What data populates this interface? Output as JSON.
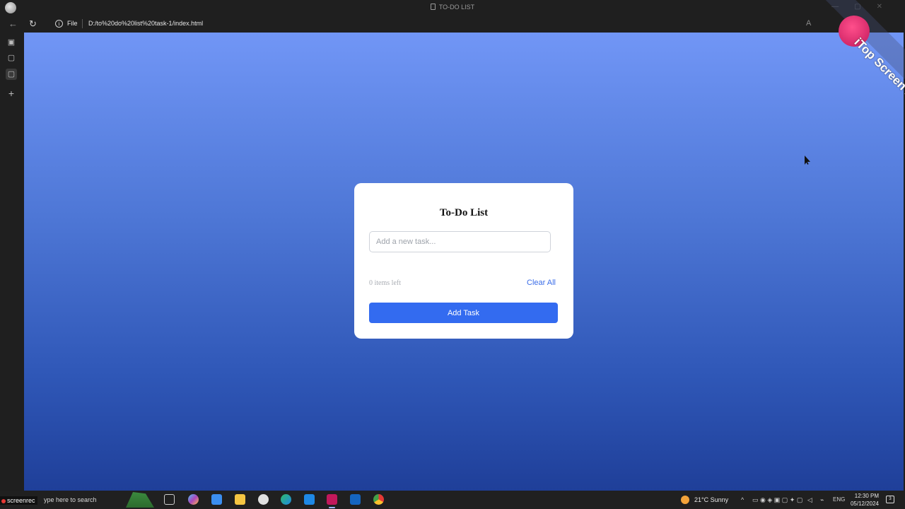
{
  "window": {
    "title": "TO-DO LIST"
  },
  "browser": {
    "file_label": "File",
    "url": "D:/to%20do%20list%20task-1/index.html"
  },
  "todo": {
    "title": "To-Do List",
    "input_placeholder": "Add a new task...",
    "input_value": "",
    "items_left": "0 items left",
    "clear_all": "Clear All",
    "add_task": "Add Task"
  },
  "watermark": {
    "text": "iTop Screen Recorder"
  },
  "taskbar": {
    "screenrec_label": "screenrec",
    "search_text": "ype here to search",
    "weather": "21°C  Sunny",
    "language": "ENG",
    "time": "12:30 PM",
    "date": "05/12/2024",
    "notification_count": "3"
  },
  "colors": {
    "accent": "#336bf0",
    "link": "#3b6de8",
    "bg_top": "#7196f6",
    "bg_bottom": "#1f3f99"
  }
}
